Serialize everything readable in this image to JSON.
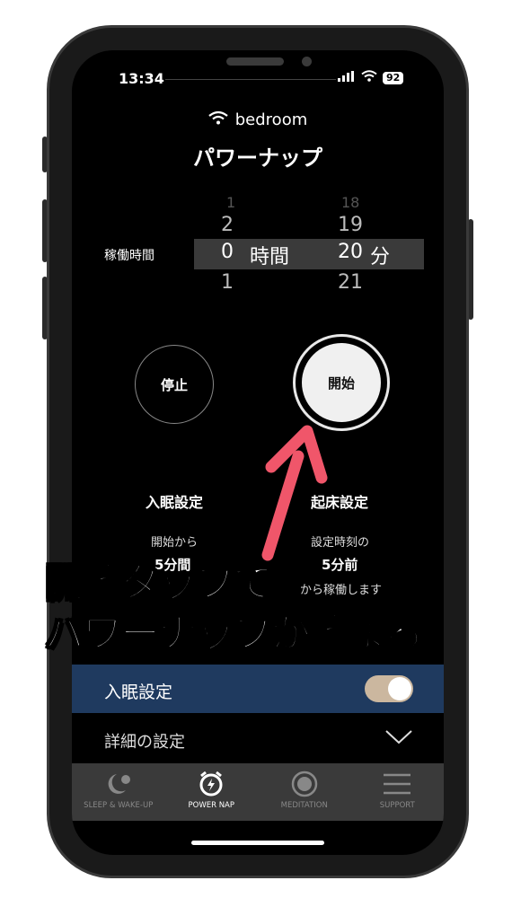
{
  "status": {
    "time": "13:34",
    "battery": "92"
  },
  "header": {
    "ssid": "bedroom",
    "title": "パワーナップ"
  },
  "picker": {
    "label": "稼働時間",
    "hours_above_faint": "1",
    "hours_above": "2",
    "hours_selected": "0",
    "hours_unit": "時間",
    "hours_below": "1",
    "minutes_above_faint": "18",
    "minutes_above": "19",
    "minutes_selected": "20",
    "minutes_unit": "分",
    "minutes_below": "21"
  },
  "buttons": {
    "stop": "停止",
    "start": "開始"
  },
  "sleep_col": {
    "title": "入眠設定",
    "line1": "開始から",
    "value": "5分間"
  },
  "wake_col": {
    "title": "起床設定",
    "line1": "設定時刻の",
    "value": "5分前",
    "line2": "から稼働します"
  },
  "overlay": {
    "line1": "開始タップで",
    "line2": "パワーナップが始まる"
  },
  "settings": {
    "sleep_label": "入眠設定",
    "detail_label": "詳細の設定"
  },
  "tabs": [
    {
      "label": "SLEEP & WAKE-UP"
    },
    {
      "label": "POWER NAP"
    },
    {
      "label": "MEDITATION"
    },
    {
      "label": "SUPPORT"
    }
  ],
  "colors": {
    "accent_row": "#1f3a5f",
    "arrow": "#f0566a",
    "toggle": "#cbb79f"
  }
}
